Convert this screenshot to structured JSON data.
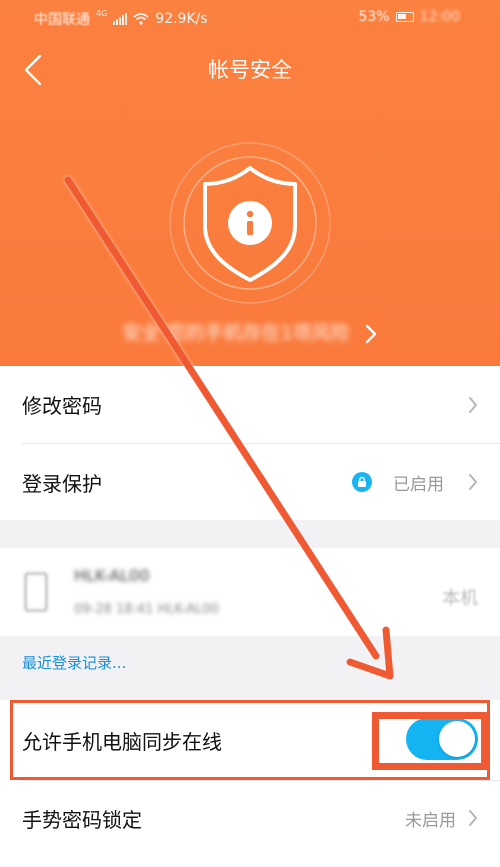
{
  "status_bar": {
    "carrier": "中国联通",
    "network_badge": "4G",
    "speed": "92.9K/s",
    "battery": "53%",
    "time": "12:00"
  },
  "header": {
    "title": "帐号安全",
    "risk_text": "安全 您的手机存在1项风险",
    "bg_color": "#fa7c3d"
  },
  "security": {
    "change_password": "修改密码",
    "login_protection": "登录保护",
    "login_protection_status": "已启用"
  },
  "device": {
    "name": "HLK-AL00",
    "info": "09-28 18:41 HLK-AL00",
    "this_device": "本机"
  },
  "recent_login": "最近登录记录...",
  "sync_online": {
    "label": "允许手机电脑同步在线",
    "enabled": true
  },
  "gesture_lock": {
    "label": "手势密码锁定",
    "status": "未启用"
  },
  "colors": {
    "accent": "#14b4f3",
    "annotation": "#ef5a32"
  }
}
